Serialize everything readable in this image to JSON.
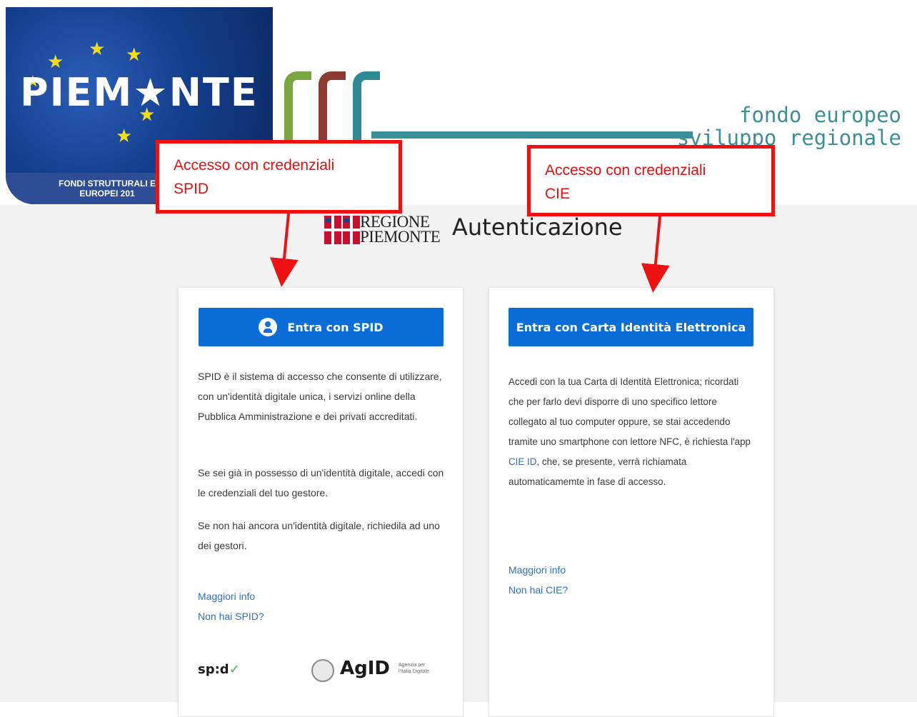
{
  "header": {
    "logo_left": {
      "wordmark": "PIEM★NTE",
      "funds_text_line1": "FONDI STRUTTURALI E",
      "funds_text_line2": "EUROPEI 201"
    },
    "fesr_line1": "fondo europeo",
    "fesr_line2": "sviluppo regionale"
  },
  "title_bar": {
    "regione_line1": "REGIONE",
    "regione_line2": "PIEMONTE",
    "title": "Autenticazione"
  },
  "spid_card": {
    "button_label": "Entra con SPID",
    "button_icon": "user-circle-icon",
    "paragraphs": [
      "SPID è il sistema di accesso che consente di utilizzare, con un'identità digitale unica, i servizi online della Pubblica Amministrazione e dei privati accreditati.",
      "Se sei già in possesso di un'identità digitale, accedi con le credenziali del tuo gestore.",
      "Se non hai ancora un'identità digitale, richiedila ad uno dei gestori."
    ],
    "link_more": "Maggiori info",
    "link_no_account": "Non hai SPID?",
    "spid_logo": "sp:d",
    "agid_logo": "AgID",
    "agid_sub_line1": "Agenzia per",
    "agid_sub_line2": "l'Italia Digitale"
  },
  "cie_card": {
    "button_label": "Entra con Carta Identità Elettronica",
    "paragraph_before_link": "Accedi con la tua Carta di Identità Elettronica; ricordati che per farlo devi disporre di uno specifico lettore collegato al tuo computer oppure, se stai accedendo tramite uno smartphone con lettore NFC, è richiesta l'app ",
    "inline_link": "CIE ID",
    "paragraph_after_link": ", che, se presente, verrà richiamata automaticamemte in fase di accesso.",
    "link_more": "Maggiori info",
    "link_no_account": "Non hai CIE?"
  },
  "annotations": {
    "spid_line1": "Accesso con credenziali",
    "spid_line2": "SPID",
    "cie_line1": "Accesso con credenziali",
    "cie_line2": "CIE",
    "color": "#ee1111"
  },
  "colors": {
    "primary_button": "#0b6ed8",
    "link": "#2e6fc1",
    "page_background": "#f2f2f2",
    "fesr_teal": "#3c8f96"
  }
}
